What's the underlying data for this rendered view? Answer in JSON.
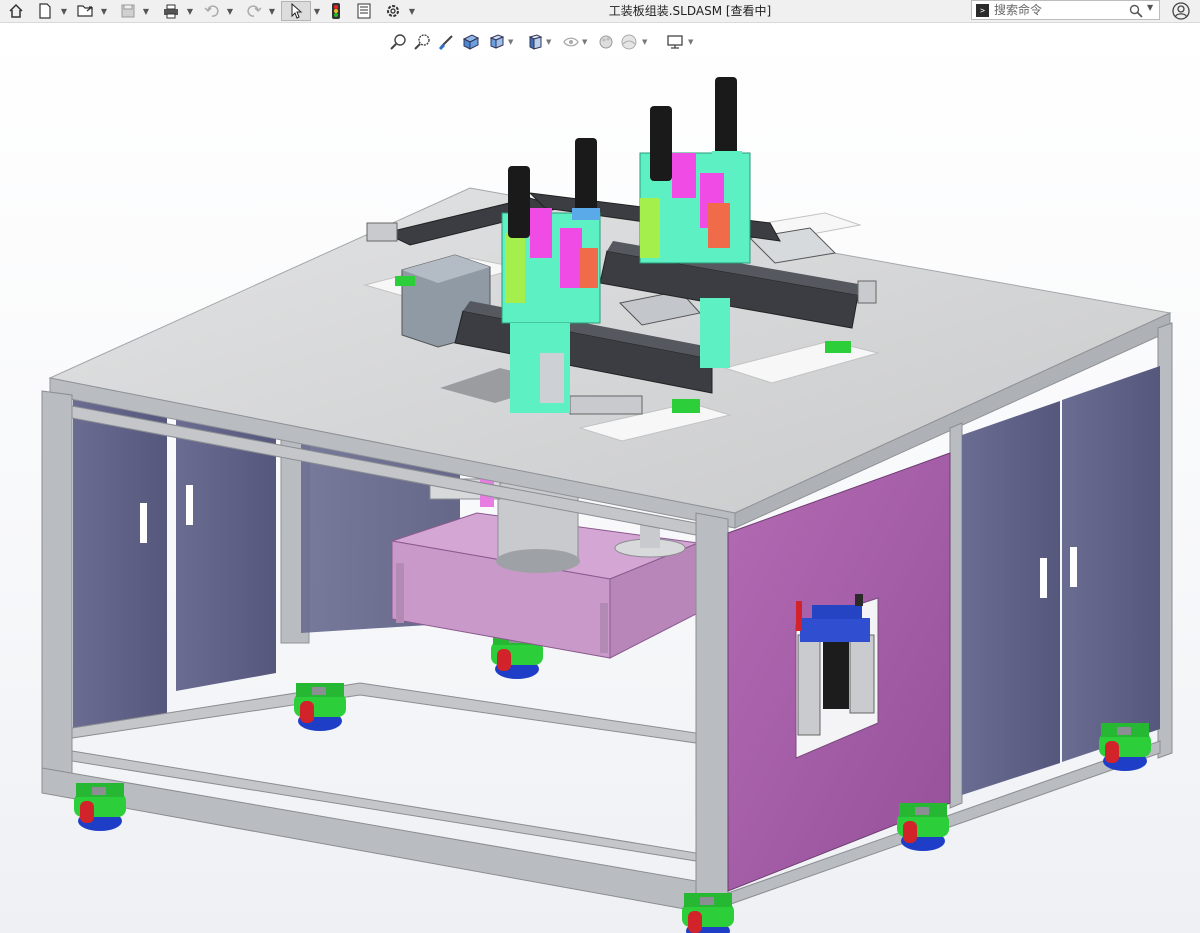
{
  "window": {
    "title": "工装板组装.SLDASM [查看中]"
  },
  "toolbar": {
    "icons": [
      "home-icon",
      "new-document-icon",
      "open-folder-icon",
      "save-icon",
      "print-icon",
      "undo-icon",
      "redo-icon",
      "select-arrow-icon",
      "rebuild-traffic-light-icon",
      "file-properties-icon",
      "options-gear-icon"
    ]
  },
  "search": {
    "placeholder": "搜索命令",
    "icon": "search-icon"
  },
  "heads_up_toolbar": {
    "icons": [
      "zoom-to-fit-icon",
      "zoom-to-area-icon",
      "previous-view-icon",
      "section-view-icon",
      "view-orientation-icon",
      "display-style-icon",
      "hide-show-items-icon",
      "edit-appearance-icon",
      "apply-scene-icon",
      "view-settings-icon"
    ]
  },
  "colors": {
    "frame": "#b9bcc0",
    "tabletop": "#d6d7d8",
    "door_panel": "#5e6085",
    "purple_panel": "#a45aa3",
    "caster_green": "#2ccf3a",
    "caster_red": "#d2232a",
    "caster_blue": "#1f3ec7",
    "rail": "#3b3d42",
    "cyan_part": "#5cf0c2",
    "magenta_part": "#f14be6",
    "platform": "#c99ac9"
  }
}
